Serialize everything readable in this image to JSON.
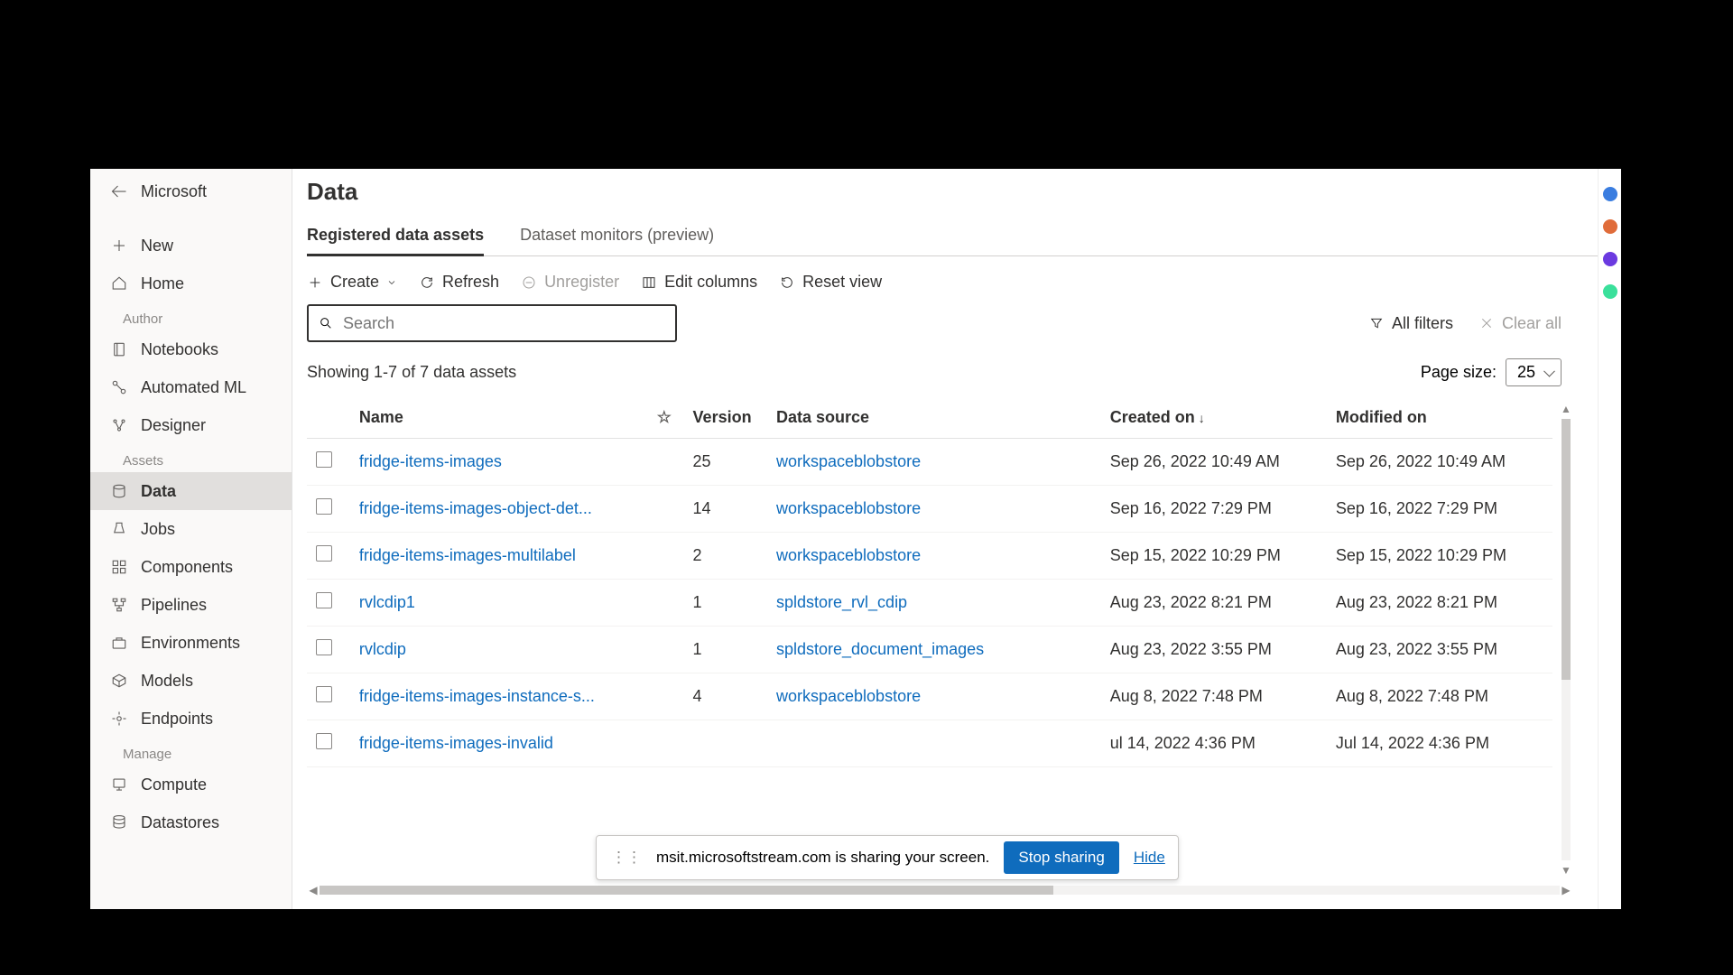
{
  "brand": "Microsoft",
  "sidebar": {
    "new": "New",
    "home": "Home",
    "sections": {
      "author": "Author",
      "assets": "Assets",
      "manage": "Manage"
    },
    "author_items": [
      "Notebooks",
      "Automated ML",
      "Designer"
    ],
    "assets_items": [
      "Data",
      "Jobs",
      "Components",
      "Pipelines",
      "Environments",
      "Models",
      "Endpoints"
    ],
    "manage_items": [
      "Compute",
      "Datastores"
    ],
    "active": "Data"
  },
  "page": {
    "title": "Data"
  },
  "tabs": [
    {
      "label": "Registered data assets",
      "active": true
    },
    {
      "label": "Dataset monitors (preview)",
      "active": false
    }
  ],
  "toolbar": {
    "create": "Create",
    "refresh": "Refresh",
    "unregister": "Unregister",
    "edit_columns": "Edit columns",
    "reset_view": "Reset view"
  },
  "search": {
    "placeholder": "Search"
  },
  "filters": {
    "all": "All filters",
    "clear": "Clear all"
  },
  "list_meta": {
    "count_text": "Showing 1-7 of 7 data assets",
    "page_size_label": "Page size:",
    "page_size_value": "25"
  },
  "columns": {
    "name": "Name",
    "version": "Version",
    "data_source": "Data source",
    "created_on": "Created on",
    "modified_on": "Modified on",
    "created_sort": "↓"
  },
  "rows": [
    {
      "name": "fridge-items-images",
      "version": "25",
      "source": "workspaceblobstore",
      "created": "Sep 26, 2022 10:49 AM",
      "modified": "Sep 26, 2022 10:49 AM"
    },
    {
      "name": "fridge-items-images-object-det...",
      "version": "14",
      "source": "workspaceblobstore",
      "created": "Sep 16, 2022 7:29 PM",
      "modified": "Sep 16, 2022 7:29 PM"
    },
    {
      "name": "fridge-items-images-multilabel",
      "version": "2",
      "source": "workspaceblobstore",
      "created": "Sep 15, 2022 10:29 PM",
      "modified": "Sep 15, 2022 10:29 PM"
    },
    {
      "name": "rvlcdip1",
      "version": "1",
      "source": "spldstore_rvl_cdip",
      "created": "Aug 23, 2022 8:21 PM",
      "modified": "Aug 23, 2022 8:21 PM"
    },
    {
      "name": "rvlcdip",
      "version": "1",
      "source": "spldstore_document_images",
      "created": "Aug 23, 2022 3:55 PM",
      "modified": "Aug 23, 2022 3:55 PM"
    },
    {
      "name": "fridge-items-images-instance-s...",
      "version": "4",
      "source": "workspaceblobstore",
      "created": "Aug 8, 2022 7:48 PM",
      "modified": "Aug 8, 2022 7:48 PM"
    },
    {
      "name": "fridge-items-images-invalid",
      "version": "",
      "source": "",
      "created": "ul 14, 2022 4:36 PM",
      "modified": "Jul 14, 2022 4:36 PM"
    }
  ],
  "share_bar": {
    "message": "msit.microsoftstream.com is sharing your screen.",
    "stop": "Stop sharing",
    "hide": "Hide"
  }
}
